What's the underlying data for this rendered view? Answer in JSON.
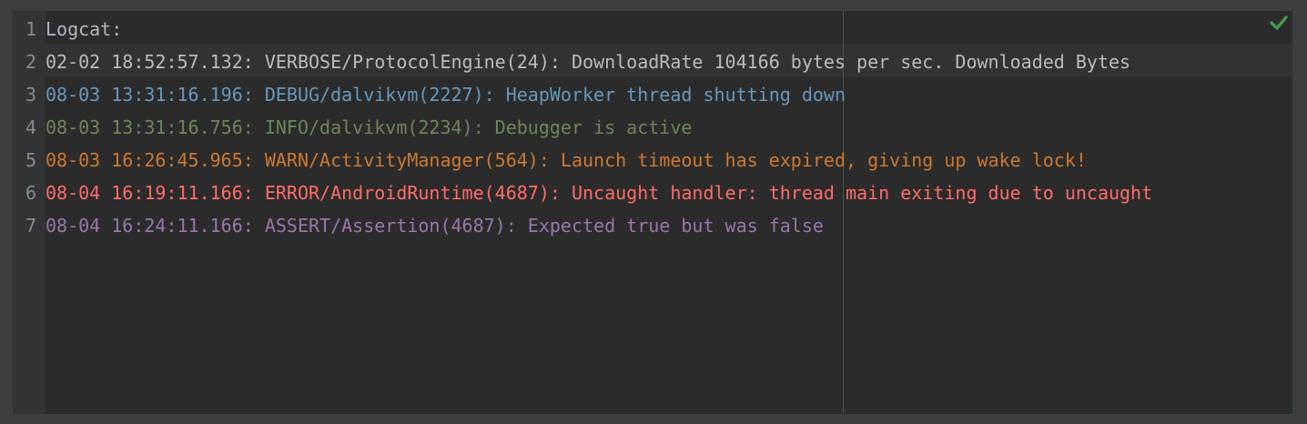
{
  "colors": {
    "default": "#a9b7c6",
    "verbose": "#bbbbbb",
    "debug": "#6897bb",
    "info": "#6a8759",
    "warn": "#cc7832",
    "error": "#ff6b68",
    "assert": "#9876aa",
    "check": "#499c54"
  },
  "status_icon": "check-icon",
  "lines": [
    {
      "number": "1",
      "text": "Logcat:",
      "level": "default"
    },
    {
      "number": "2",
      "text": "02-02 18:52:57.132: VERBOSE/ProtocolEngine(24): DownloadRate 104166 bytes per sec. Downloaded Bytes",
      "level": "verbose"
    },
    {
      "number": "3",
      "text": "08-03 13:31:16.196: DEBUG/dalvikvm(2227): HeapWorker thread shutting down",
      "level": "debug"
    },
    {
      "number": "4",
      "text": "08-03 13:31:16.756: INFO/dalvikvm(2234): Debugger is active",
      "level": "info"
    },
    {
      "number": "5",
      "text": "08-03 16:26:45.965: WARN/ActivityManager(564): Launch timeout has expired, giving up wake lock!",
      "level": "warn"
    },
    {
      "number": "6",
      "text": "08-04 16:19:11.166: ERROR/AndroidRuntime(4687): Uncaught handler: thread main exiting due to uncaught",
      "level": "error"
    },
    {
      "number": "7",
      "text": "08-04 16:24:11.166: ASSERT/Assertion(4687): Expected true but was false",
      "level": "assert"
    }
  ]
}
